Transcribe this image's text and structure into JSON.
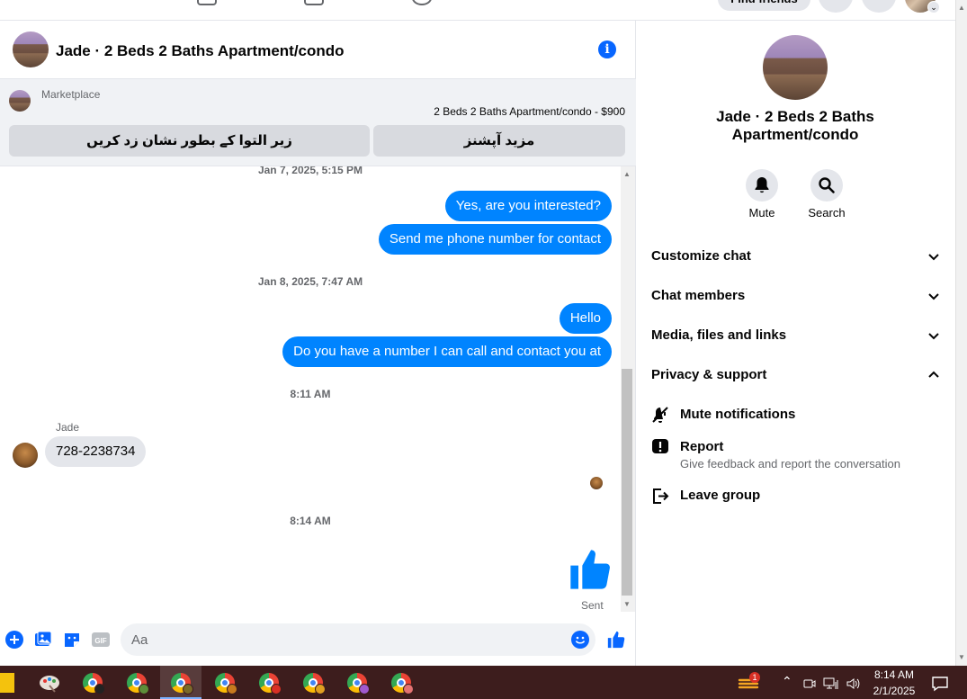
{
  "topnav": {
    "find_friends_label": "Find friends"
  },
  "chat": {
    "title": "Jade · 2 Beds 2 Baths Apartment/condo",
    "marketplace_label": "Marketplace",
    "listing": "2 Beds 2 Baths Apartment/condo - $900",
    "mark_unread_label": "زیر التوا کے بطور نشان زد کریں",
    "more_options_label": "مزید آپشنز",
    "messages": [
      {
        "type": "timestamp",
        "text": "Jan 7, 2025, 5:15 PM"
      },
      {
        "type": "out",
        "text": "Yes, are you interested?"
      },
      {
        "type": "out",
        "text": "Send me phone number for contact"
      },
      {
        "type": "timestamp",
        "text": "Jan 8, 2025, 7:47 AM"
      },
      {
        "type": "out",
        "text": "Hello"
      },
      {
        "type": "out",
        "text": "Do you have a number I can call and contact you at"
      },
      {
        "type": "timestamp",
        "text": "8:11 AM"
      },
      {
        "type": "sender",
        "text": "Jade"
      },
      {
        "type": "in",
        "text": "728-2238734"
      },
      {
        "type": "timestamp",
        "text": "8:14 AM"
      },
      {
        "type": "status",
        "text": "Sent"
      }
    ],
    "composer_placeholder": "Aa"
  },
  "details": {
    "title": "Jade · 2 Beds 2 Baths Apartment/condo",
    "mute_label": "Mute",
    "search_label": "Search",
    "sections": [
      {
        "label": "Customize chat",
        "expanded": false
      },
      {
        "label": "Chat members",
        "expanded": false
      },
      {
        "label": "Media, files and links",
        "expanded": false
      },
      {
        "label": "Privacy & support",
        "expanded": true
      }
    ],
    "options": [
      {
        "label": "Mute notifications",
        "sub": ""
      },
      {
        "label": "Report",
        "sub": "Give feedback and report the conversation"
      },
      {
        "label": "Leave group",
        "sub": ""
      }
    ]
  },
  "taskbar": {
    "time": "8:14 AM",
    "date": "2/1/2025",
    "notification_count": "1"
  },
  "colors": {
    "messenger_blue": "#0084ff",
    "accent_blue": "#0866ff",
    "taskbar_bg": "#3d1d1d"
  }
}
